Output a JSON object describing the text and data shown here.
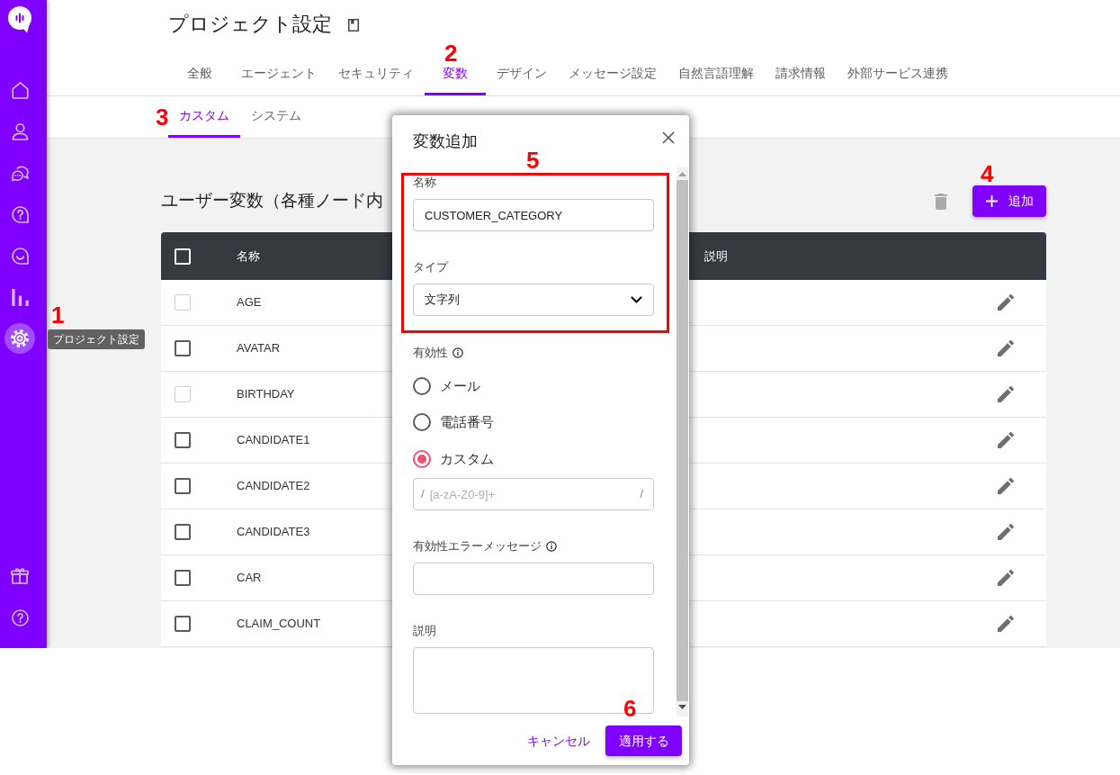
{
  "sidebar": {
    "nav_items": [
      {
        "selected": false
      },
      {
        "selected": false
      },
      {
        "selected": false
      },
      {
        "selected": false
      },
      {
        "selected": false
      },
      {
        "selected": false
      },
      {
        "selected": true
      }
    ],
    "tooltip": "プロジェクト設定"
  },
  "header": {
    "title": "プロジェクト設定",
    "tabs": [
      {
        "label": "全般",
        "selected": false
      },
      {
        "label": "エージェント",
        "selected": false
      },
      {
        "label": "セキュリティ",
        "selected": false
      },
      {
        "label": "変数",
        "selected": true
      },
      {
        "label": "デザイン",
        "selected": false
      },
      {
        "label": "メッセージ設定",
        "selected": false
      },
      {
        "label": "自然言語理解",
        "selected": false
      },
      {
        "label": "請求情報",
        "selected": false
      },
      {
        "label": "外部サービス連携",
        "selected": false
      }
    ]
  },
  "sub_tabs": [
    {
      "label": "カスタム",
      "selected": true
    },
    {
      "label": "システム",
      "selected": false
    }
  ],
  "section": {
    "heading": "ユーザー変数（各種ノード内",
    "delete_button": {
      "disabled": true
    },
    "add_button": "追加"
  },
  "table": {
    "select_all": {
      "checked": false
    },
    "columns": [
      "名称",
      "説明"
    ],
    "rows": [
      {
        "name": "AGE",
        "checked": false,
        "disabled": true
      },
      {
        "name": "AVATAR",
        "checked": false,
        "disabled": false
      },
      {
        "name": "BIRTHDAY",
        "checked": false,
        "disabled": true
      },
      {
        "name": "CANDIDATE1",
        "checked": false,
        "disabled": false
      },
      {
        "name": "CANDIDATE2",
        "checked": false,
        "disabled": false
      },
      {
        "name": "CANDIDATE3",
        "checked": false,
        "disabled": false
      },
      {
        "name": "CAR",
        "checked": false,
        "disabled": false
      },
      {
        "name": "CLAIM_COUNT",
        "checked": false,
        "disabled": false
      }
    ]
  },
  "dialog": {
    "title": "変数追加",
    "name_label": "名称",
    "name_value": "CUSTOMER_CATEGORY",
    "type_label": "タイプ",
    "type_value": "文字列",
    "validity_label": "有効性",
    "validity_options": [
      {
        "label": "メール",
        "selected": false
      },
      {
        "label": "電話番号",
        "selected": false
      },
      {
        "label": "カスタム",
        "selected": true
      }
    ],
    "pattern": {
      "prefix": "/",
      "placeholder": "[a-zA-Z0-9]+",
      "suffix": "/"
    },
    "error_message_label": "有効性エラーメッセージ",
    "description_label": "説明",
    "cancel_button": "キャンセル",
    "apply_button": "適用する"
  },
  "annotations": [
    "1",
    "2",
    "3",
    "4",
    "5",
    "6"
  ]
}
